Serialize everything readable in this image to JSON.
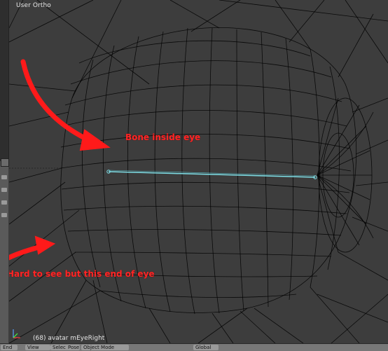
{
  "viewport": {
    "title": "User Ortho",
    "object_info": "(68) avatar mEyeRight"
  },
  "annotations": {
    "bone_label": "Bone inside eye",
    "eye_end_label": "Hard to see but this end of eye"
  },
  "footer": {
    "end_label": "End",
    "object_mode_label": "Object Mode",
    "global_label": "Global",
    "view_label": "View",
    "select_label": "Select",
    "pose_label": "Pose"
  },
  "colors": {
    "background": "#3d3d3d",
    "wireframe": "#000000",
    "bone": "#7fe0e8",
    "annotation": "#ff2626"
  }
}
